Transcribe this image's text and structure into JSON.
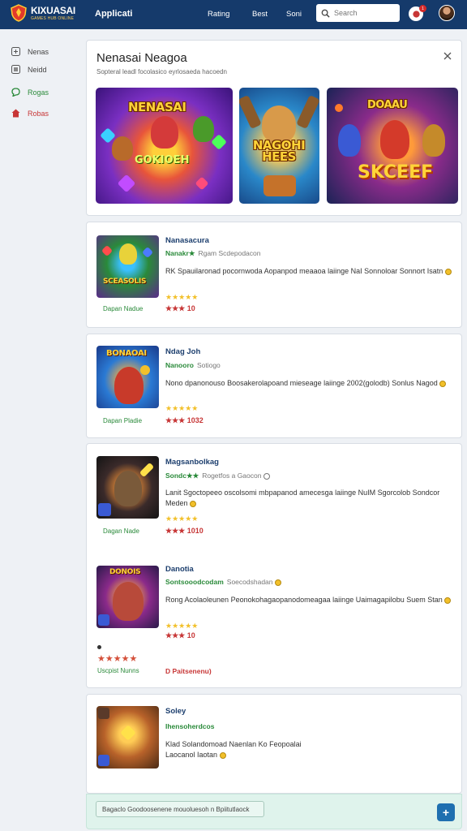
{
  "header": {
    "logo_name": "KIXUASAI",
    "logo_tagline": "GAMES HUB ONLINE",
    "app_title": "Applicati",
    "nav": [
      "Rating",
      "Best",
      "Soni"
    ],
    "search_placeholder": "Search",
    "notification_count": "1"
  },
  "sidebar": {
    "items": [
      {
        "label": "Nenas",
        "icon": "square-plus-icon"
      },
      {
        "label": "Neidd",
        "icon": "square-icon"
      },
      {
        "label": "Rogas",
        "icon": "chat-icon"
      },
      {
        "label": "Robas",
        "icon": "home-icon"
      }
    ]
  },
  "featured": {
    "title": "Nenasai Neagoa",
    "subtitle": "Sopteral leadl focolasico eyrlosaeda hacoedn",
    "banners": [
      {
        "title": "NENASAI",
        "subtitle": "GOKIOEH"
      },
      {
        "title": "NAGOHI HEES",
        "subtitle": ""
      },
      {
        "title": "DOAAU",
        "subtitle": "SKCEEF"
      }
    ]
  },
  "games": [
    {
      "name": "Nanasacura",
      "dev": "Nanakr★",
      "dev_extra": "Rgam Scdepodacon",
      "desc": "RK Spauilaronad pocornwoda Aopanpod meaaoa laiinge NaI Sonnoloar Sonnort Isatn",
      "thumb_title": "SCEASOLIS",
      "tag": "Dapan Nadue",
      "stars_gold": "★★★★★",
      "stars_red": "★★★ 10"
    },
    {
      "name": "Ndag Joh",
      "dev": "Nanooro",
      "dev_extra": "Sotiogo",
      "desc": "Nono dpanonouso Boosakerolapoand mieseage laiinge 2002(golodb) Sonlus Nagod",
      "thumb_title": "BONAOAI",
      "tag": "Dapan Pladie",
      "stars_gold": "★★★★★",
      "stars_red": "★★★ 1032"
    },
    {
      "name": "Magsanbolkag",
      "dev": "Sondc★★",
      "dev_extra": "Rogetfos a Gaocon",
      "desc": "Lanit Sgoctopeeo oscolsomi mbpapanod amecesga laiinge NuIM Sgorcolob Sondcor Meden",
      "thumb_title": "",
      "tag": "Dagan Nade",
      "stars_gold": "★★★★★",
      "stars_red": "★★★ 1010"
    },
    {
      "name": "Danotia",
      "dev": "Sontsooodcodam",
      "dev_extra": "Soecodshadan",
      "desc": "Rong Acolaoleunen Peonokohagaopanodomeagaa laiinge Uaimagapilobu Suem Stan",
      "thumb_title": "DONOIS",
      "tag": "Uscpist Nunns",
      "stars_gold": "★★★★★",
      "stars_red": "★★★ 10",
      "extra_stars": "★★★★★",
      "extra_label": "D  Paitsenenu)"
    },
    {
      "name": "Soley",
      "dev": "Ihensoherdcos",
      "dev_extra": "",
      "desc": "Klad Solandomoad Naenlan Ko Feopoalai Laocanol Iaotan",
      "thumb_title": "",
      "tag": ""
    }
  ],
  "footer": {
    "field_text": "Bagaclo Goodoosenene mouoluesoh  n  Bpiitutlaock",
    "fab_label": "+"
  },
  "colors": {
    "header_bg": "#153a6b",
    "accent_green": "#2a8a3a",
    "accent_red": "#c73636",
    "star_gold": "#f2c02a"
  }
}
